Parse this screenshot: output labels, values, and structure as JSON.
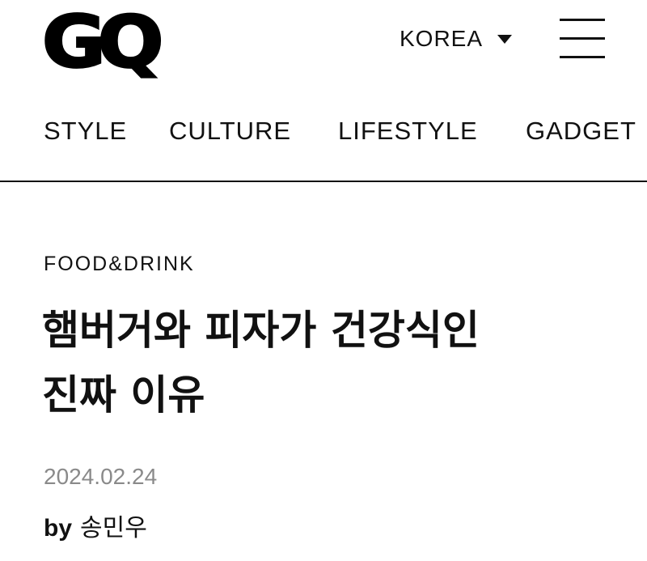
{
  "header": {
    "logo_text": "GQ",
    "region_label": "KOREA",
    "region_caret_icon": "caret-down-icon",
    "menu_icon": "hamburger-menu-icon"
  },
  "nav": {
    "items": [
      "STYLE",
      "CULTURE",
      "LIFESTYLE",
      "GADGET"
    ]
  },
  "article": {
    "category": "FOOD&DRINK",
    "title_line1": "햄버거와 피자가 건강식인",
    "title_line2": "진짜 이유",
    "date": "2024.02.24",
    "byline_prefix": "by",
    "author": "송민우"
  }
}
